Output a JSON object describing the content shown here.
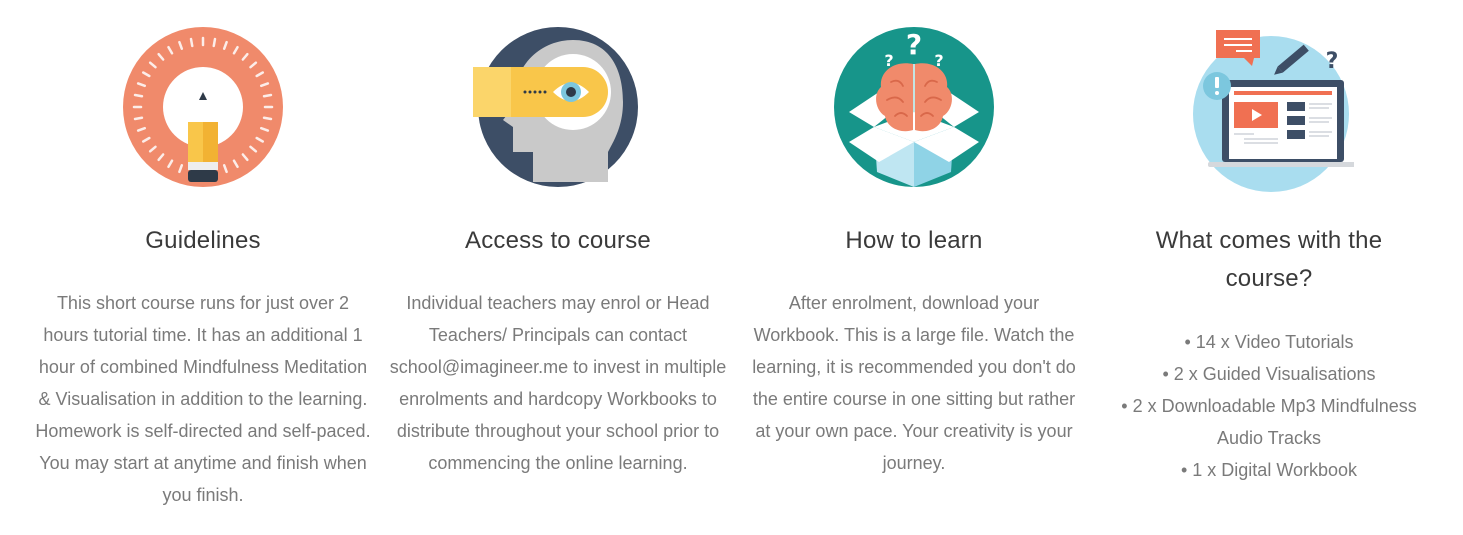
{
  "features": [
    {
      "icon": "pencil-dial-icon",
      "title": "Guidelines",
      "body": "This short course runs for just over 2 hours tutorial time. It has an additional 1 hour of combined Mindfulness Meditation & Visualisation in addition to the learning. Homework is self-directed and self-paced. You may start at anytime and finish when you finish."
    },
    {
      "icon": "head-eye-icon",
      "title": "Access to course",
      "body": "Individual teachers may enrol or Head Teachers/ Principals can contact school@imagineer.me to invest in multiple enrolments and hardcopy Workbooks to distribute throughout your school prior to commencing the online learning."
    },
    {
      "icon": "brain-box-icon",
      "title": "How to learn",
      "body": "After enrolment, download your Workbook. This is a large file. Watch the learning, it is recommended you don't do the entire course in one sitting but rather at your own pace. Your creativity is your journey."
    },
    {
      "icon": "laptop-video-icon",
      "title": "What comes with the course?",
      "items": [
        "14 x Video Tutorials",
        "2 x Guided Visualisations",
        "2 x Downloadable Mp3 Mindfulness Audio Tracks",
        "1 x Digital Workbook"
      ]
    }
  ],
  "colors": {
    "coral": "#F08A6B",
    "navy": "#3D4E66",
    "teal": "#17958A",
    "sky": "#A9DDEF",
    "yellow": "#F9C64A",
    "title_text": "#3a3a3a",
    "body_text": "#7a7a7a"
  }
}
